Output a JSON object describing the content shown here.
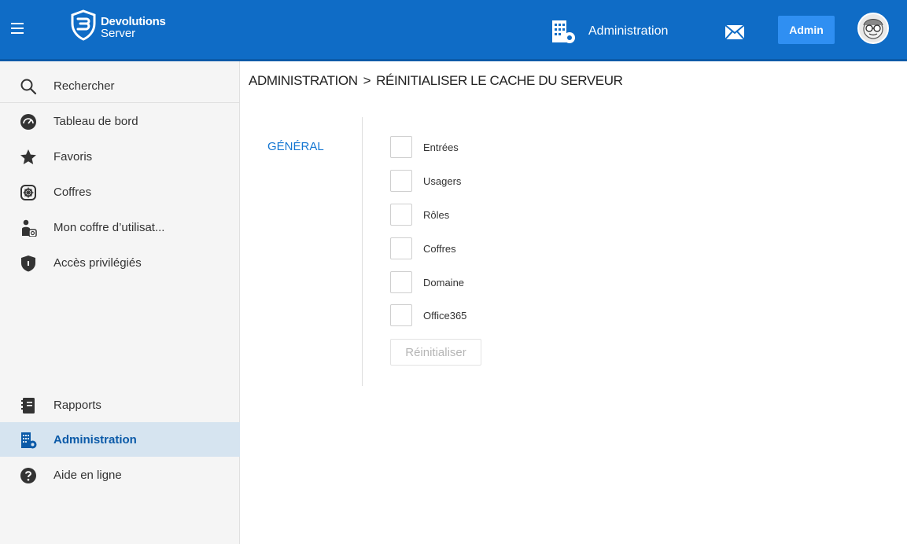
{
  "header": {
    "brand_line1": "Devolutions",
    "brand_line2": "Server",
    "section_label": "Administration",
    "admin_button": "Admin",
    "accent_color": "#0f6cc6"
  },
  "sidebar": {
    "items": [
      {
        "label": "Rechercher",
        "icon": "search-icon"
      },
      {
        "label": "Tableau de bord",
        "icon": "dashboard-icon"
      },
      {
        "label": "Favoris",
        "icon": "star-icon"
      },
      {
        "label": "Coffres",
        "icon": "vault-icon"
      },
      {
        "label": "Mon coffre d’utilisat...",
        "icon": "user-vault-icon"
      },
      {
        "label": "Accès privilégiés",
        "icon": "shield-icon"
      },
      {
        "label": "Rapports",
        "icon": "report-icon"
      },
      {
        "label": "Administration",
        "icon": "admin-building-icon",
        "active": true
      },
      {
        "label": "Aide en ligne",
        "icon": "help-icon"
      }
    ]
  },
  "main": {
    "breadcrumb": {
      "root": "ADMINISTRATION",
      "separator": ">",
      "current": "RÉINITIALISER LE CACHE DU SERVEUR"
    },
    "tab": "GÉNÉRAL",
    "checkboxes": [
      {
        "label": "Entrées",
        "checked": false
      },
      {
        "label": "Usagers",
        "checked": false
      },
      {
        "label": "Rôles",
        "checked": false
      },
      {
        "label": "Coffres",
        "checked": false
      },
      {
        "label": "Domaine",
        "checked": false
      },
      {
        "label": "Office365",
        "checked": false
      }
    ],
    "reset_button": "Réinitialiser"
  }
}
